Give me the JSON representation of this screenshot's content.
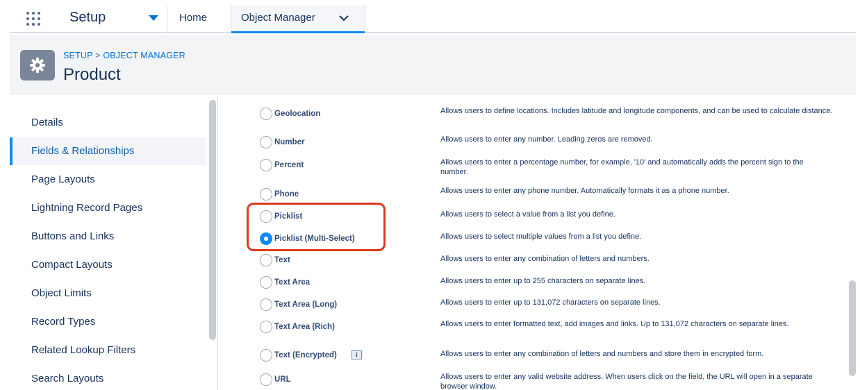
{
  "topbar": {
    "app_name": "Setup",
    "home_label": "Home",
    "active_tab_label": "Object Manager"
  },
  "header": {
    "breadcrumb_setup": "SETUP",
    "breadcrumb_sep": ">",
    "breadcrumb_object_manager": "OBJECT MANAGER",
    "title": "Product"
  },
  "sidebar": {
    "items": [
      {
        "label": "Details"
      },
      {
        "label": "Fields & Relationships",
        "active": true
      },
      {
        "label": "Page Layouts"
      },
      {
        "label": "Lightning Record Pages"
      },
      {
        "label": "Buttons and Links"
      },
      {
        "label": "Compact Layouts"
      },
      {
        "label": "Object Limits"
      },
      {
        "label": "Record Types"
      },
      {
        "label": "Related Lookup Filters"
      },
      {
        "label": "Search Layouts"
      }
    ]
  },
  "field_types": [
    {
      "label": "Geolocation",
      "desc": "Allows users to define locations. Includes latitude and longitude components, and can be used to calculate distance.",
      "checked": false
    },
    {
      "label": "Number",
      "desc": "Allows users to enter any number. Leading zeros are removed.",
      "checked": false
    },
    {
      "label": "Percent",
      "desc": "Allows users to enter a percentage number, for example, '10' and automatically adds the percent sign to the number.",
      "checked": false
    },
    {
      "label": "Phone",
      "desc": "Allows users to enter any phone number. Automatically formats it as a phone number.",
      "checked": false
    },
    {
      "label": "Picklist",
      "desc": "Allows users to select a value from a list you define.",
      "checked": false
    },
    {
      "label": "Picklist (Multi-Select)",
      "desc": "Allows users to select multiple values from a list you define.",
      "checked": true
    },
    {
      "label": "Text",
      "desc": "Allows users to enter any combination of letters and numbers.",
      "checked": false
    },
    {
      "label": "Text Area",
      "desc": "Allows users to enter up to 255 characters on separate lines.",
      "checked": false
    },
    {
      "label": "Text Area (Long)",
      "desc": "Allows users to enter up to 131,072 characters on separate lines.",
      "checked": false
    },
    {
      "label": "Text Area (Rich)",
      "desc": "Allows users to enter formatted text, add images and links. Up to 131,072 characters on separate lines.",
      "checked": false
    },
    {
      "label": "Text (Encrypted)",
      "desc": "Allows users to enter any combination of letters and numbers and store them in encrypted form.",
      "checked": false,
      "info_icon": "i"
    },
    {
      "label": "URL",
      "desc": "Allows users to enter any valid website address. When users click on the field, the URL will open in a separate browser window.",
      "checked": false
    }
  ],
  "colors": {
    "accent": "#1589ee",
    "link": "#0070d2",
    "highlight": "#e0391b"
  },
  "icons": {
    "app_launcher": "app-launcher-icon",
    "dropdown": "chevron-down-icon",
    "setup_gear": "gear-icon",
    "info": "info-icon"
  }
}
